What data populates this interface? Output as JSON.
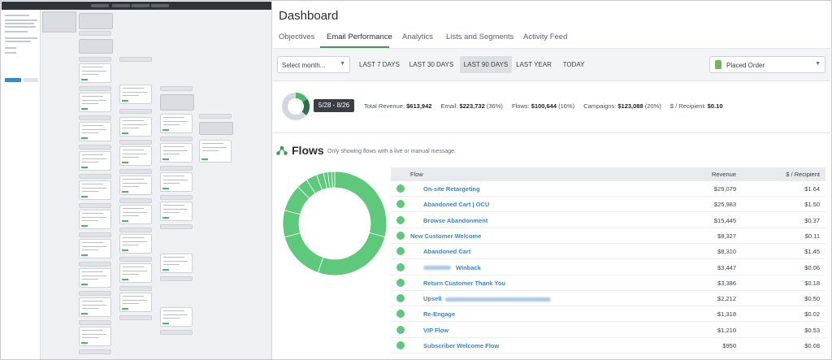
{
  "dashboard": {
    "title": "Dashboard",
    "tabs": [
      {
        "label": "Objectives"
      },
      {
        "label": "Email Performance"
      },
      {
        "label": "Analytics"
      },
      {
        "label": "Lists and Segments"
      },
      {
        "label": "Activity Feed"
      }
    ],
    "active_tab": "Email Performance"
  },
  "filters": {
    "month_select": "Select month...",
    "ranges": [
      "LAST 7 DAYS",
      "LAST 30 DAYS",
      "LAST 90 DAYS",
      "LAST YEAR",
      "TODAY"
    ],
    "active_range": "LAST 90 DAYS",
    "metric_select": "Placed Order",
    "metric_icon": "shopify-bag-icon"
  },
  "summary": {
    "date_range": "5/28 - 8/26",
    "total_label": "Total Revenue:",
    "total_value": "$613,942",
    "email_label": "Email:",
    "email_value": "$223,732",
    "email_pct": "(36%)",
    "flows_label": "Flows:",
    "flows_value": "$100,644",
    "flows_pct": "(16%)",
    "campaigns_label": "Campaigns:",
    "campaigns_value": "$123,088",
    "campaigns_pct": "(20%)",
    "per_recipient_label": "$ / Recipient:",
    "per_recipient_value": "$0.10",
    "flows_share": 0.16,
    "campaigns_share": 0.2
  },
  "flows": {
    "title": "Flows",
    "subtitle": "Only showing flows with a live or manual message.",
    "col_flow": "Flow",
    "col_revenue": "Revenue",
    "col_per_recipient": "$ / Recipient",
    "rows": [
      {
        "name": "On-site Retargeting",
        "revenue": "$29,079",
        "per": "$1.64",
        "indent": true
      },
      {
        "name": "Abandoned Cart | OCU",
        "revenue": "$25,983",
        "per": "$1.50",
        "indent": true
      },
      {
        "name": "Browse Abandonment",
        "revenue": "$15,445",
        "per": "$0.37",
        "indent": true
      },
      {
        "name": "New Customer Welcome",
        "revenue": "$8,327",
        "per": "$0.11",
        "indent": false
      },
      {
        "name": "Abandoned Cart",
        "revenue": "$8,310",
        "per": "$1.45",
        "indent": true
      },
      {
        "name": "Winback",
        "revenue": "$3,447",
        "per": "$0.06",
        "indent": true,
        "redacted_before": true
      },
      {
        "name": "Return Customer Thank You",
        "revenue": "$3,386",
        "per": "$0.18",
        "indent": true
      },
      {
        "name": "Upsell",
        "revenue": "$2,212",
        "per": "$0.50",
        "indent": true,
        "redacted_after": true
      },
      {
        "name": "Re-Engage",
        "revenue": "$1,318",
        "per": "$0.02",
        "indent": true
      },
      {
        "name": "VIP Flow",
        "revenue": "$1,210",
        "per": "$0.53",
        "indent": true
      },
      {
        "name": "Subscriber Welcome Flow",
        "revenue": "$950",
        "per": "$0.08",
        "indent": true
      }
    ],
    "donut_color": "#5ec97a"
  }
}
